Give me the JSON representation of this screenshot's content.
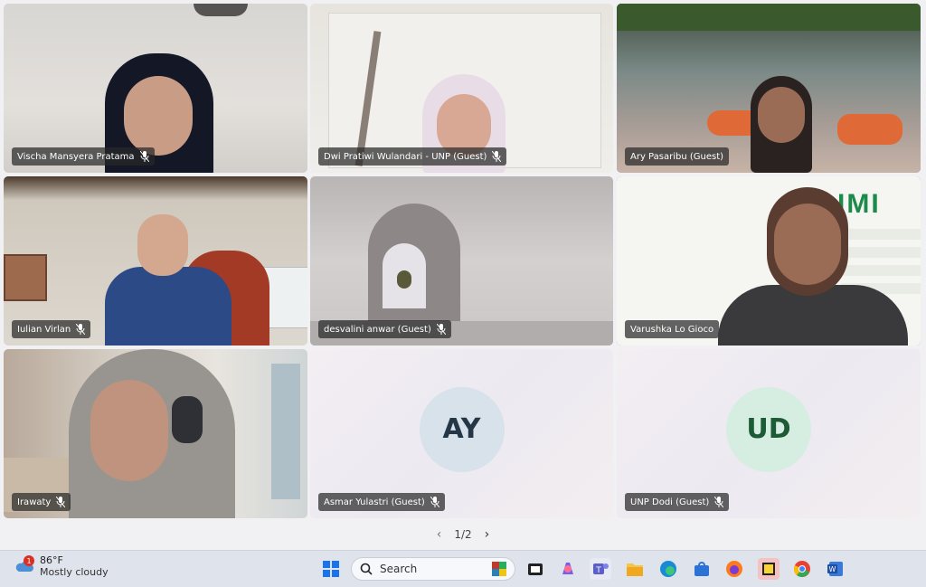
{
  "participants": [
    {
      "name": "Vischa Mansyera Pratama"
    },
    {
      "name": "Dwi Pratiwi Wulandari - UNP (Guest)"
    },
    {
      "name": "Ary Pasaribu (Guest)"
    },
    {
      "name": "Iulian Virlan"
    },
    {
      "name": "desvalini anwar (Guest)"
    },
    {
      "name": "Varushka Lo Gioco"
    },
    {
      "name": "Irawaty"
    },
    {
      "name": "Asmar Yulastri (Guest)",
      "initials": "AY"
    },
    {
      "name": "UNP Dodi (Guest)",
      "initials": "UD"
    }
  ],
  "pager": {
    "label": "1/2"
  },
  "background_logo": "IMI",
  "taskbar": {
    "weather": {
      "temp": "86°F",
      "condition": "Mostly cloudy",
      "badge": "1"
    },
    "search": {
      "label": "Search"
    },
    "apps": [
      "start-icon",
      "search-icon",
      "widgets-icon",
      "copilot-icon",
      "teams-icon",
      "file-explorer-icon",
      "edge-icon",
      "store-icon",
      "firefox-icon",
      "sticky-notes-icon",
      "chrome-icon",
      "word-icon"
    ]
  },
  "colors": {
    "active_border": "#7b63c9",
    "avatar_ay_bg": "#d7e2ea",
    "avatar_ud_bg": "#d6eee1"
  }
}
